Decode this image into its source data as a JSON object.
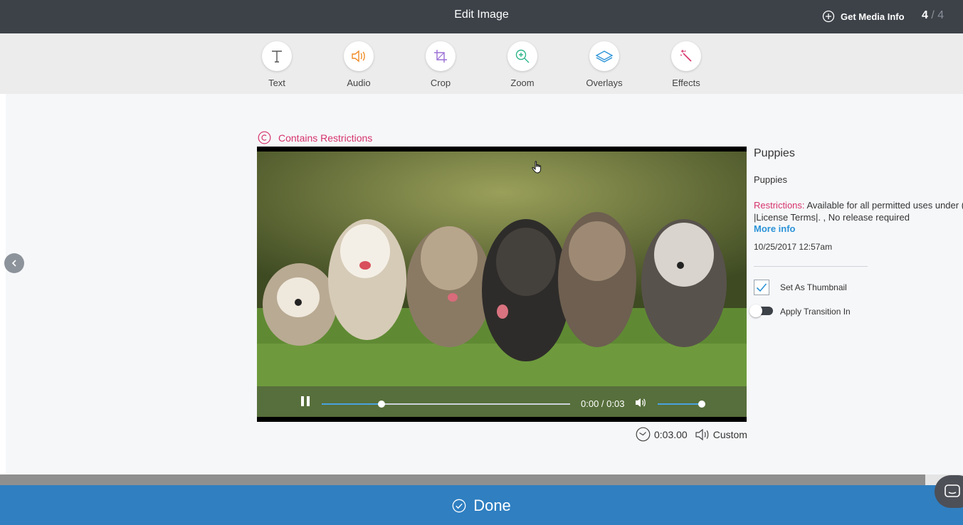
{
  "header": {
    "title": "Edit Image",
    "media_info_label": "Get Media Info",
    "counter_current": "4",
    "counter_sep": "/",
    "counter_total": "4"
  },
  "toolbar": {
    "items": [
      {
        "label": "Text",
        "icon": "text-icon",
        "color": "#555555"
      },
      {
        "label": "Audio",
        "icon": "audio-icon",
        "color": "#f08a24"
      },
      {
        "label": "Crop",
        "icon": "crop-icon",
        "color": "#9b6fd6"
      },
      {
        "label": "Zoom",
        "icon": "zoom-icon",
        "color": "#2db58a"
      },
      {
        "label": "Overlays",
        "icon": "overlays-icon",
        "color": "#2b93d8"
      },
      {
        "label": "Effects",
        "icon": "effects-icon",
        "color": "#d6336c"
      }
    ]
  },
  "restriction_notice": {
    "label": "Contains Restrictions",
    "icon": "copyright-icon",
    "color": "#d6336c"
  },
  "player": {
    "time": "0:00 / 0:03",
    "seek_progress": 0.24,
    "volume_level": 1.0,
    "duration_label": "0:03.00",
    "audio_label": "Custom",
    "accent": "#4aa3df"
  },
  "info": {
    "title": "Puppies",
    "caption": "Puppies",
    "restrictions_label": "Restrictions:",
    "restrictions_line1": "Available for all permitted uses under (",
    "restrictions_line2": "|License Terms|. , No release required",
    "more_info": "More info",
    "date": "10/25/2017 12:57am",
    "thumbnail_label": "Set As Thumbnail",
    "thumbnail_checked": true,
    "transition_label": "Apply Transition In",
    "transition_on": false
  },
  "footer": {
    "done_label": "Done",
    "done_color": "#2f7fc1"
  }
}
